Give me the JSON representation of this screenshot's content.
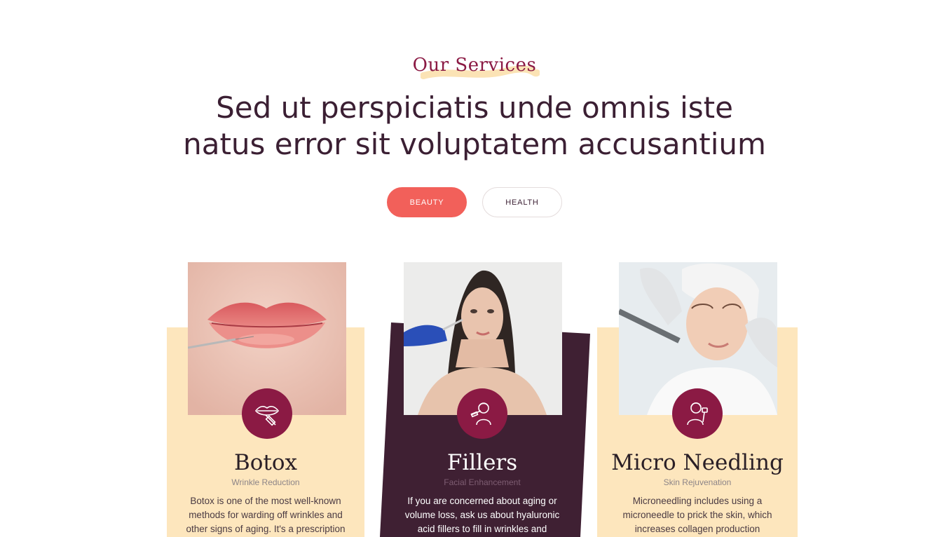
{
  "section": {
    "eyebrow": "Our Services",
    "headline_line1": "Sed ut perspiciatis unde omnis iste",
    "headline_line2": "natus error sit voluptatem accusantium"
  },
  "tabs": [
    {
      "label": "BEAUTY",
      "active": true
    },
    {
      "label": "HEALTH",
      "active": false
    }
  ],
  "cards": [
    {
      "title": "Botox",
      "subtitle": "Wrinkle Reduction",
      "description": "Botox is one of the most well-known methods for warding off wrinkles and other signs of aging. It's a prescription",
      "icon": "lips-syringe-icon",
      "theme": "light"
    },
    {
      "title": "Fillers",
      "subtitle": "Facial Enhancement",
      "description": "If you are concerned about aging or volume loss, ask us about hyaluronic acid fillers to fill in wrinkles and",
      "icon": "face-syringe-icon",
      "theme": "dark"
    },
    {
      "title": "Micro Needling",
      "subtitle": "Skin Rejuvenation",
      "description": "Microneedling includes using a microneedle to prick the skin, which increases collagen production",
      "icon": "face-roller-icon",
      "theme": "light"
    }
  ],
  "colors": {
    "accent_coral": "#f2605a",
    "accent_burgundy": "#8b1a44",
    "card_cream": "#fde6bd",
    "card_plum": "#3f2033",
    "heading": "#3b1f33"
  }
}
